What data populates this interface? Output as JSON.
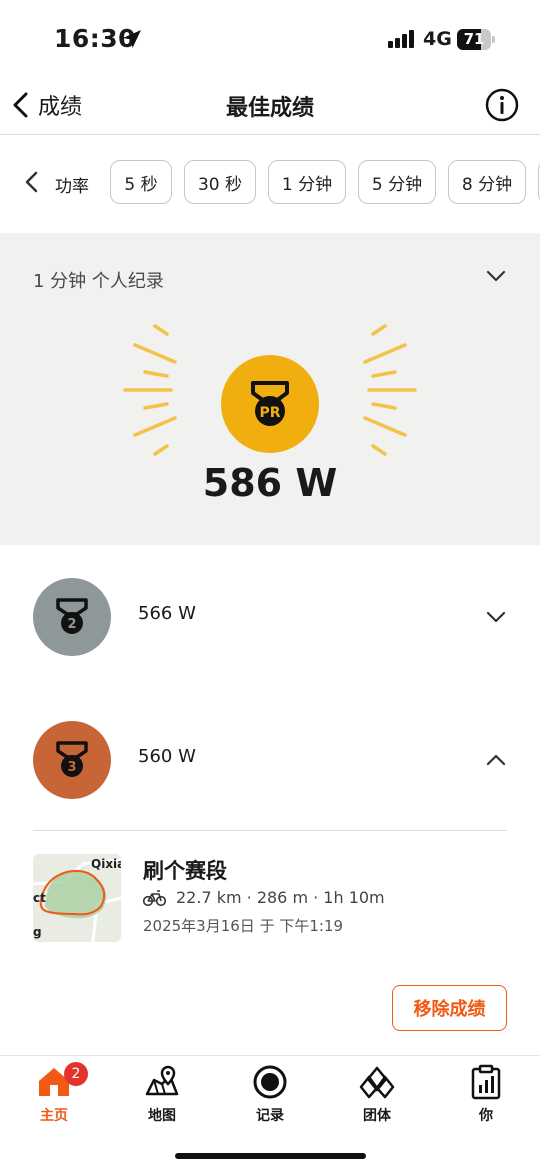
{
  "status_bar": {
    "time": "16:30",
    "network": "4G",
    "battery": "71",
    "battery_level": 0.71
  },
  "nav": {
    "back_label": "成绩",
    "title": "最佳成绩"
  },
  "filters": {
    "category": "功率",
    "options": [
      "5 秒",
      "30 秒",
      "1 分钟",
      "5 分钟",
      "8 分钟"
    ],
    "selected": "1 分钟"
  },
  "personal_record": {
    "title": "1 分钟 个人纪录",
    "medal_label": "PR",
    "value": "586 W"
  },
  "ranks": [
    {
      "rank": "2",
      "value": "566 W",
      "medal_color": "#8f9898",
      "expanded": false
    },
    {
      "rank": "3",
      "value": "560 W",
      "medal_color": "#c86536",
      "expanded": true
    }
  ],
  "activity": {
    "title": "刷个赛段",
    "stats": "22.7 km · 286 m · 1h 10m",
    "date": "2025年3月16日 于 下午1:19",
    "map_label_top": "Qixia",
    "map_label_left": "ct",
    "map_label_bottom": "g"
  },
  "remove_button": "移除成绩",
  "tabs": [
    {
      "label": "主页",
      "icon": "home-icon",
      "active": true,
      "badge": "2"
    },
    {
      "label": "地图",
      "icon": "map-icon",
      "active": false
    },
    {
      "label": "记录",
      "icon": "record-icon",
      "active": false
    },
    {
      "label": "团体",
      "icon": "groups-icon",
      "active": false
    },
    {
      "label": "你",
      "icon": "profile-icon",
      "active": false
    }
  ],
  "colors": {
    "accent": "#f05a14",
    "pr_gold": "#f1ae0f",
    "silver": "#8f9898",
    "bronze": "#c86536",
    "hero_bg": "#f1f1ef"
  }
}
